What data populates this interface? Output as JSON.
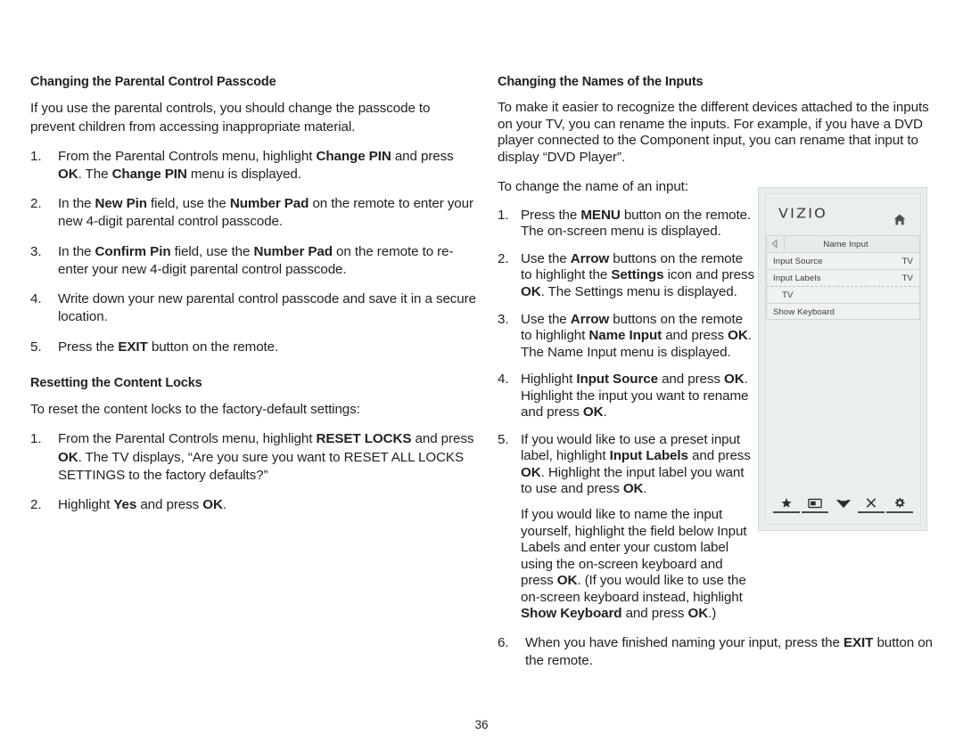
{
  "page": {
    "number": "36"
  },
  "left_column": {
    "section1": {
      "heading": "Changing the Parental Control Passcode",
      "intro": "If you use the parental controls, you should change the passcode to prevent children from accessing inappropriate material.",
      "steps": [
        {
          "num": "1.",
          "parts": [
            {
              "t": "From the Parental Controls menu, highlight ",
              "b": false
            },
            {
              "t": "Change PIN",
              "b": true
            },
            {
              "t": " and press ",
              "b": false
            },
            {
              "t": "OK",
              "b": true
            },
            {
              "t": ". The ",
              "b": false
            },
            {
              "t": "Change PIN",
              "b": true
            },
            {
              "t": " menu is displayed.",
              "b": false
            }
          ]
        },
        {
          "num": "2.",
          "parts": [
            {
              "t": "In the ",
              "b": false
            },
            {
              "t": "New Pin",
              "b": true
            },
            {
              "t": " field, use the ",
              "b": false
            },
            {
              "t": "Number Pad",
              "b": true
            },
            {
              "t": " on the remote to enter your new 4-digit parental control passcode.",
              "b": false
            }
          ]
        },
        {
          "num": "3.",
          "parts": [
            {
              "t": "In the ",
              "b": false
            },
            {
              "t": "Confirm Pin",
              "b": true
            },
            {
              "t": " field, use the ",
              "b": false
            },
            {
              "t": "Number Pad",
              "b": true
            },
            {
              "t": " on the remote to re-enter your new 4-digit parental control passcode.",
              "b": false
            }
          ]
        },
        {
          "num": "4.",
          "parts": [
            {
              "t": "Write down your new parental control passcode and save it in a secure location.",
              "b": false
            }
          ]
        },
        {
          "num": "5.",
          "parts": [
            {
              "t": "Press the ",
              "b": false
            },
            {
              "t": "EXIT",
              "b": true
            },
            {
              "t": " button on the remote.",
              "b": false
            }
          ]
        }
      ]
    },
    "section2": {
      "heading": "Resetting the Content Locks",
      "intro": "To reset the content locks to the factory-default settings:",
      "steps": [
        {
          "num": "1.",
          "parts": [
            {
              "t": "From the Parental Controls menu, highlight ",
              "b": false
            },
            {
              "t": "RESET LOCKS",
              "b": true
            },
            {
              "t": " and press ",
              "b": false
            },
            {
              "t": "OK",
              "b": true
            },
            {
              "t": ". The TV displays, “Are you sure you want to RESET ALL LOCKS SETTINGS to the factory defaults?”",
              "b": false
            }
          ]
        },
        {
          "num": "2.",
          "parts": [
            {
              "t": "Highlight ",
              "b": false
            },
            {
              "t": "Yes",
              "b": true
            },
            {
              "t": " and press ",
              "b": false
            },
            {
              "t": "OK",
              "b": true
            },
            {
              "t": ".",
              "b": false
            }
          ]
        }
      ]
    }
  },
  "right_column": {
    "heading": "Changing the Names of the Inputs",
    "intro": "To make it easier to recognize the different devices attached to the inputs on your TV, you can rename the inputs. For example, if you have a DVD player connected to the Component input, you can rename that input to display “DVD Player”.",
    "lead": "To change the name of an input:",
    "narrow_steps": [
      {
        "num": "1.",
        "parts": [
          {
            "t": "Press the ",
            "b": false
          },
          {
            "t": "MENU",
            "b": true
          },
          {
            "t": " button on the remote. The on-screen menu is displayed.",
            "b": false
          }
        ]
      },
      {
        "num": "2.",
        "parts": [
          {
            "t": "Use the ",
            "b": false
          },
          {
            "t": "Arrow",
            "b": true
          },
          {
            "t": " buttons on the remote to highlight the ",
            "b": false
          },
          {
            "t": "Settings",
            "b": true
          },
          {
            "t": " icon and press ",
            "b": false
          },
          {
            "t": "OK",
            "b": true
          },
          {
            "t": ". The Settings menu is displayed.",
            "b": false
          }
        ]
      },
      {
        "num": "3.",
        "parts": [
          {
            "t": "Use the ",
            "b": false
          },
          {
            "t": "Arrow",
            "b": true
          },
          {
            "t": " buttons on the remote to highlight ",
            "b": false
          },
          {
            "t": "Name Input",
            "b": true
          },
          {
            "t": " and press ",
            "b": false
          },
          {
            "t": "OK",
            "b": true
          },
          {
            "t": ". The Name Input menu is displayed.",
            "b": false
          }
        ]
      },
      {
        "num": "4.",
        "parts": [
          {
            "t": "Highlight ",
            "b": false
          },
          {
            "t": "Input Source",
            "b": true
          },
          {
            "t": " and press ",
            "b": false
          },
          {
            "t": "OK",
            "b": true
          },
          {
            "t": ". Highlight the input you want to rename and press ",
            "b": false
          },
          {
            "t": "OK",
            "b": true
          },
          {
            "t": ".",
            "b": false
          }
        ]
      },
      {
        "num": "5.",
        "parts": [
          {
            "t": "If you would like to use a preset input label, highlight ",
            "b": false
          },
          {
            "t": "Input Labels",
            "b": true
          },
          {
            "t": " and press ",
            "b": false
          },
          {
            "t": "OK",
            "b": true
          },
          {
            "t": ". Highlight the input label you want to use and press ",
            "b": false
          },
          {
            "t": "OK",
            "b": true
          },
          {
            "t": ".",
            "b": false
          }
        ]
      }
    ],
    "sub_paragraph": {
      "parts": [
        {
          "t": "If you would like to name the input yourself, highlight the field below Input Labels and enter your custom label using the on-screen keyboard and press ",
          "b": false
        },
        {
          "t": "OK",
          "b": true
        },
        {
          "t": ". (If you would like to use the on-screen keyboard instead, highlight ",
          "b": false
        },
        {
          "t": "Show Keyboard",
          "b": true
        },
        {
          "t": " and press ",
          "b": false
        },
        {
          "t": "OK",
          "b": true
        },
        {
          "t": ".)",
          "b": false
        }
      ]
    },
    "wide_steps": [
      {
        "num": "6.",
        "parts": [
          {
            "t": "When you have finished naming your input, press the ",
            "b": false
          },
          {
            "t": "EXIT",
            "b": true
          },
          {
            "t": " button on the remote.",
            "b": false
          }
        ]
      }
    ]
  },
  "tv_menu": {
    "logo": "VIZIO",
    "home_icon": "home-icon",
    "title_row": {
      "back_icon": "back-arrow-icon",
      "label": "Name Input"
    },
    "rows": [
      {
        "label": "Input Source",
        "value": "TV",
        "type": "option"
      },
      {
        "label": "Input Labels",
        "value": "TV",
        "type": "option"
      },
      {
        "label": "TV",
        "value": "",
        "type": "entry"
      },
      {
        "label": "Show Keyboard",
        "value": "",
        "type": "option"
      }
    ],
    "bottom_icons": [
      "star-icon",
      "picture-icon",
      "chevron-down-icon",
      "close-x-icon",
      "gear-icon"
    ],
    "colors": {
      "panel_bg": "#e9eeed",
      "row_bg": "#eef2f1",
      "row_border": "#cdd6d5",
      "text": "#3b3b3b"
    }
  }
}
